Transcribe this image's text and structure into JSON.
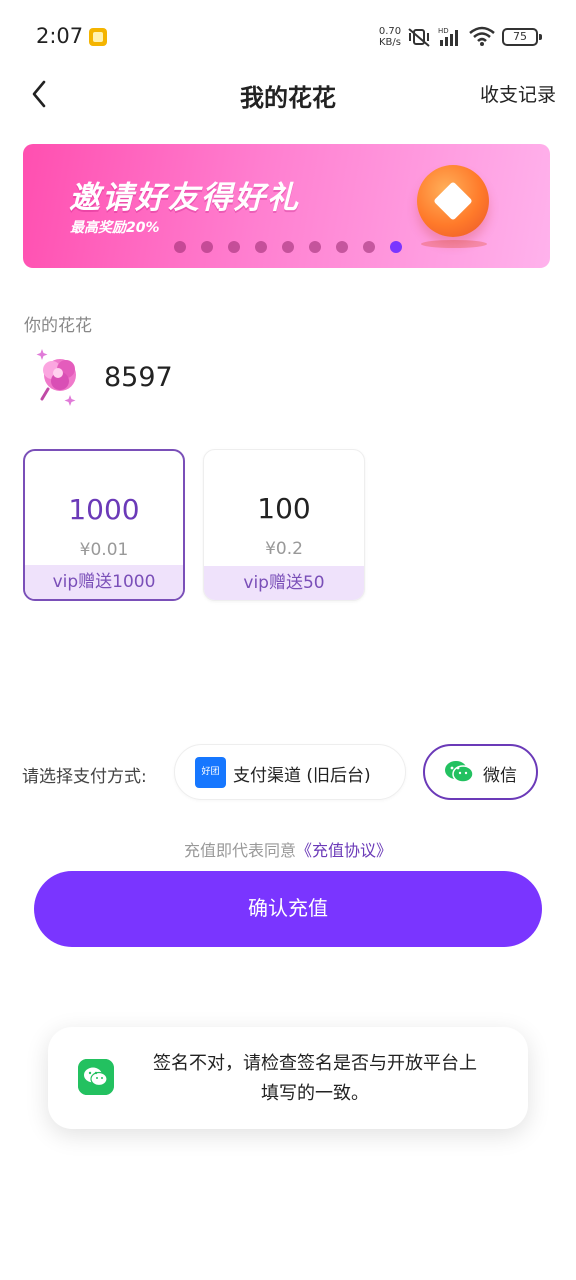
{
  "status_bar": {
    "time": "2:07",
    "network_speed": "0.70",
    "network_unit": "KB/s",
    "battery": "75"
  },
  "nav": {
    "title": "我的花花",
    "records_link": "收支记录"
  },
  "banner": {
    "title": "邀请好友得好礼",
    "subtitle": "最高奖励20%",
    "dot_count": 9,
    "active_dot_index": 8
  },
  "balance": {
    "label": "你的花花",
    "value": "8597"
  },
  "recharge_options": [
    {
      "amount": "1000",
      "price": "¥0.01",
      "bonus": "vip赠送1000",
      "selected": true
    },
    {
      "amount": "100",
      "price": "¥0.2",
      "bonus": "vip赠送50",
      "selected": false
    }
  ],
  "payment": {
    "label": "请选择支付方式:",
    "channel_icon_text": "好团",
    "options": [
      {
        "label": "支付渠道 (旧后台)",
        "selected": false
      },
      {
        "label": "微信",
        "selected": true
      }
    ]
  },
  "agreement": {
    "prefix": "充值即代表同意",
    "link": "《充值协议》"
  },
  "confirm_button": "确认充值",
  "toast": {
    "message_line1": "签名不对，请检查签名是否与开放平台上",
    "message_line2": "填写的一致。"
  },
  "colors": {
    "accent": "#7a35ff",
    "selected_border": "#6b3ab8",
    "bonus_bg": "#efe2fb",
    "wechat_green": "#23c160"
  }
}
